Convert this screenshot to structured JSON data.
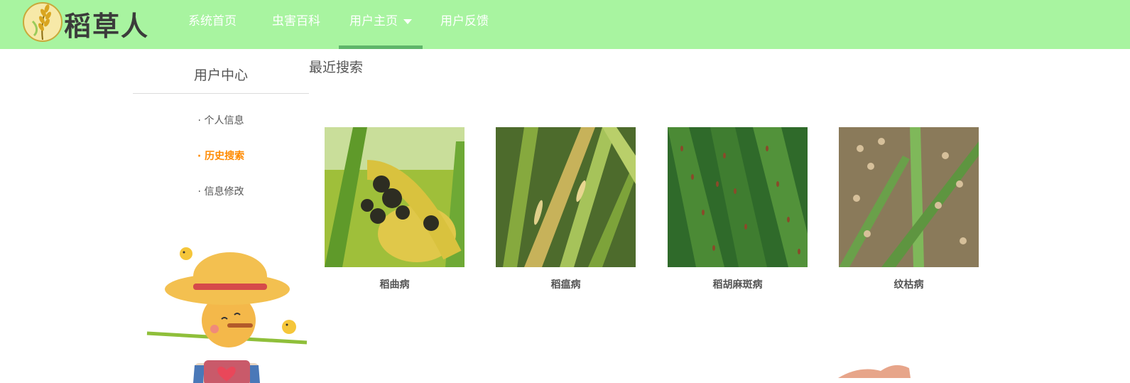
{
  "header": {
    "logo_text": "稻草人",
    "nav": [
      {
        "label": "系统首页"
      },
      {
        "label": "虫害百科"
      },
      {
        "label": "用户主页"
      },
      {
        "label": "用户反馈"
      }
    ],
    "active_index": 2,
    "colors": {
      "bar": "#a8f4a0",
      "active_underline": "#5fb66a"
    }
  },
  "sidebar": {
    "title": "用户中心",
    "links": [
      {
        "label": "· 个人信息"
      },
      {
        "label": "· 历史搜索"
      },
      {
        "label": "· 信息修改"
      }
    ],
    "active_index": 1,
    "active_color": "#ff8a00"
  },
  "main": {
    "section_title": "最近搜索",
    "cards": [
      {
        "label": "稻曲病",
        "image": "rice-false-smut-photo"
      },
      {
        "label": "稻瘟病",
        "image": "rice-blast-photo"
      },
      {
        "label": "稻胡麻斑病",
        "image": "rice-brown-spot-photo"
      },
      {
        "label": "纹枯病",
        "image": "rice-sheath-blight-photo"
      }
    ]
  }
}
